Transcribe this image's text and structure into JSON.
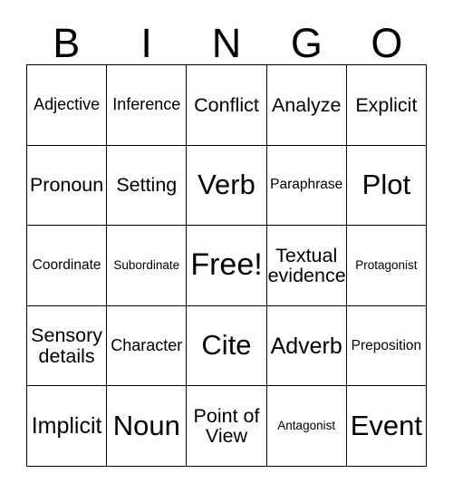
{
  "card": {
    "title": "BINGO",
    "header_letters": [
      "B",
      "I",
      "N",
      "G",
      "O"
    ],
    "border_color": "#000000",
    "background_color": "#ffffff",
    "text_color": "#000000",
    "rows": 5,
    "columns": 5,
    "cells": [
      [
        {
          "label": "Adjective",
          "size": "sz-m",
          "lines": 1
        },
        {
          "label": "Inference",
          "size": "sz-m",
          "lines": 1
        },
        {
          "label": "Conflict",
          "size": "sz-l",
          "lines": 1
        },
        {
          "label": "Analyze",
          "size": "sz-l",
          "lines": 1
        },
        {
          "label": "Explicit",
          "size": "sz-l",
          "lines": 1
        }
      ],
      [
        {
          "label": "Pronoun",
          "size": "sz-l",
          "lines": 1
        },
        {
          "label": "Setting",
          "size": "sz-l",
          "lines": 1
        },
        {
          "label": "Verb",
          "size": "sz-xxl",
          "lines": 1
        },
        {
          "label": "Paraphrase",
          "size": "sz-s",
          "lines": 1
        },
        {
          "label": "Plot",
          "size": "sz-xxl",
          "lines": 1
        }
      ],
      [
        {
          "label": "Coordinate",
          "size": "sz-s",
          "lines": 1
        },
        {
          "label": "Subordinate",
          "size": "sz-xs",
          "lines": 1
        },
        {
          "label": "Free!",
          "size": "sz-free",
          "lines": 1,
          "is_free_space": true
        },
        {
          "label": "Textual\nevidence",
          "size": "sz-l",
          "lines": 2
        },
        {
          "label": "Protagonist",
          "size": "sz-xs",
          "lines": 1
        }
      ],
      [
        {
          "label": "Sensory\ndetails",
          "size": "sz-l",
          "lines": 2
        },
        {
          "label": "Character",
          "size": "sz-m",
          "lines": 1
        },
        {
          "label": "Cite",
          "size": "sz-xxl",
          "lines": 1
        },
        {
          "label": "Adverb",
          "size": "sz-xl",
          "lines": 1
        },
        {
          "label": "Preposition",
          "size": "sz-s",
          "lines": 1
        }
      ],
      [
        {
          "label": "Implicit",
          "size": "sz-xl",
          "lines": 1
        },
        {
          "label": "Noun",
          "size": "sz-xxl",
          "lines": 1
        },
        {
          "label": "Point of\nView",
          "size": "sz-l",
          "lines": 2
        },
        {
          "label": "Antagonist",
          "size": "sz-xs",
          "lines": 1
        },
        {
          "label": "Event",
          "size": "sz-xxl",
          "lines": 1
        }
      ]
    ]
  }
}
